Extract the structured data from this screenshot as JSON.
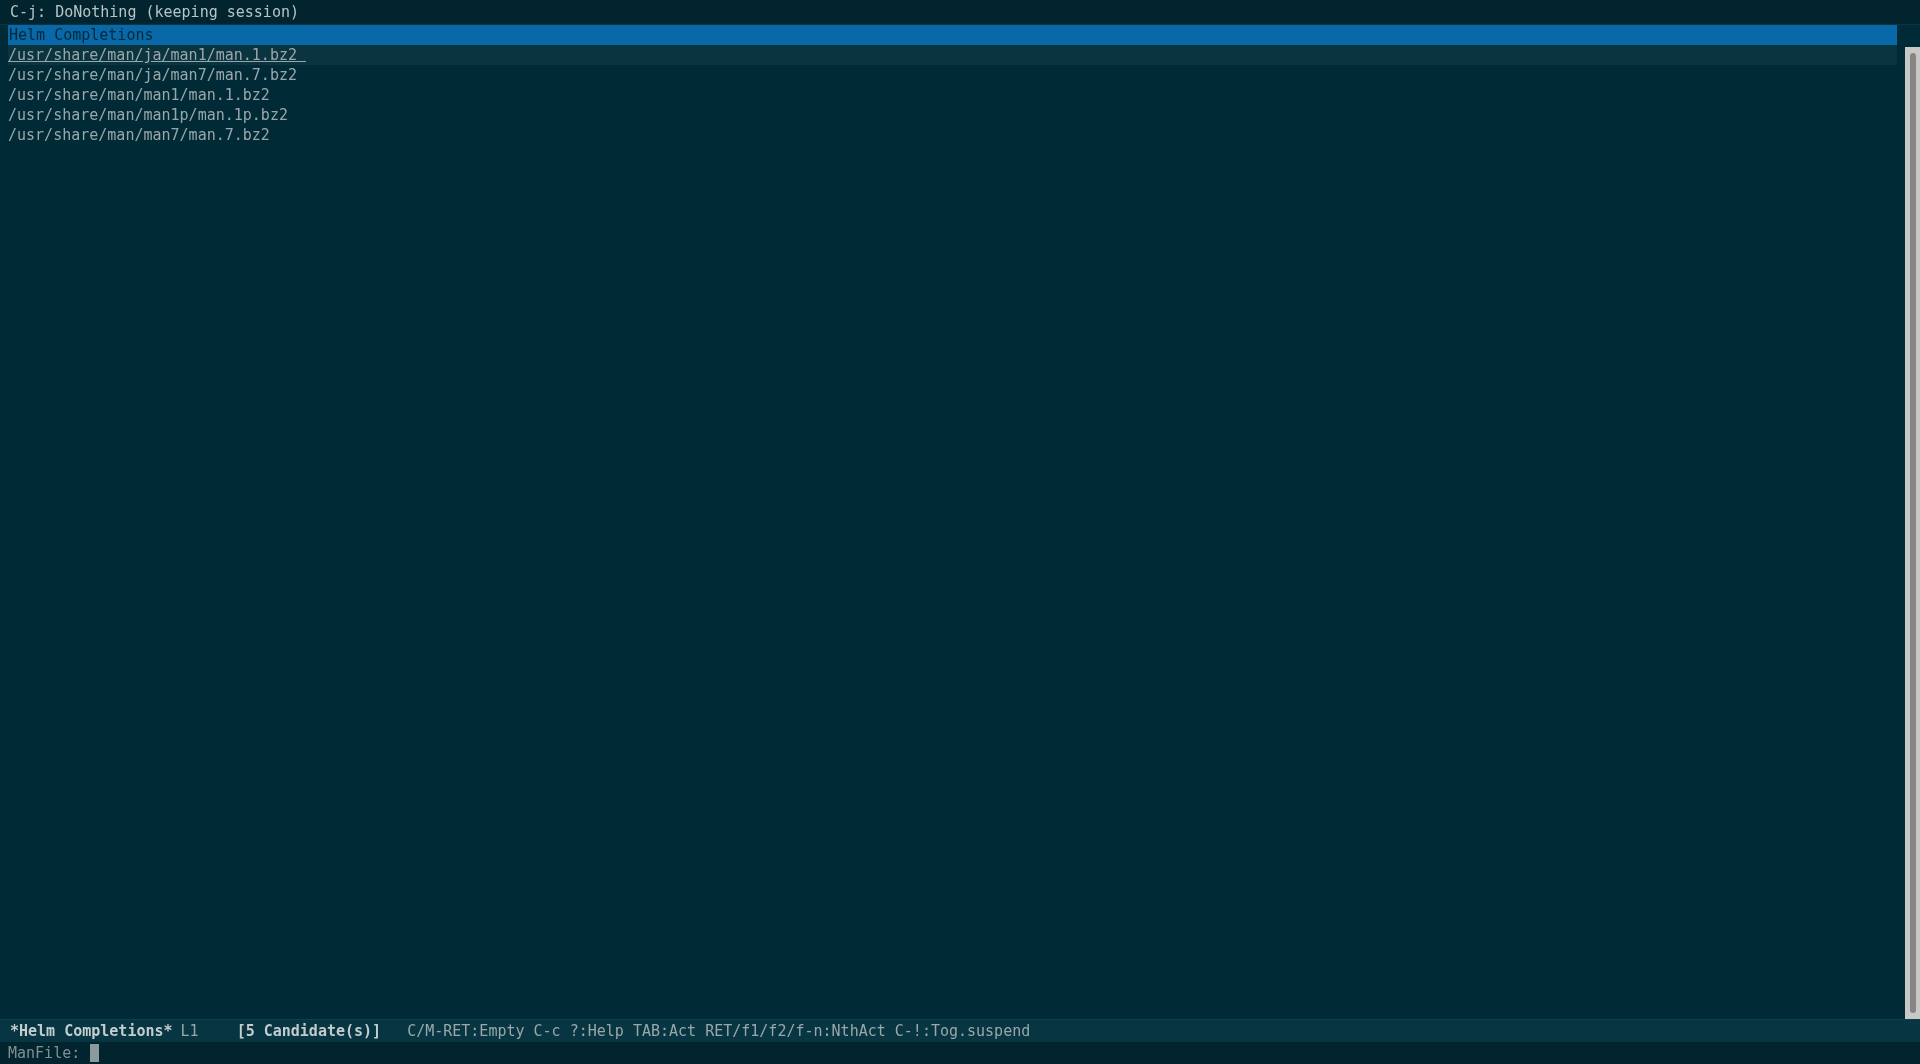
{
  "header_line": "C-j: DoNothing (keeping session)",
  "source": {
    "title": "Helm Completions",
    "candidates": [
      {
        "path": "/usr/share/man/ja/man1/man.1.bz2",
        "selected": true
      },
      {
        "path": "/usr/share/man/ja/man7/man.7.bz2",
        "selected": false
      },
      {
        "path": "/usr/share/man/man1/man.1.bz2",
        "selected": false
      },
      {
        "path": "/usr/share/man/man1p/man.1p.bz2",
        "selected": false
      },
      {
        "path": "/usr/share/man/man7/man.7.bz2",
        "selected": false
      }
    ]
  },
  "mode_line": {
    "buffer": "*Helm Completions*",
    "line": "L1",
    "count": "[5 Candidate(s)]",
    "keys": "C/M-RET:Empty C-c ?:Help TAB:Act RET/f1/f2/f-n:NthAct C-!:Tog.suspend"
  },
  "minibuffer": {
    "prompt": "ManFile:"
  }
}
